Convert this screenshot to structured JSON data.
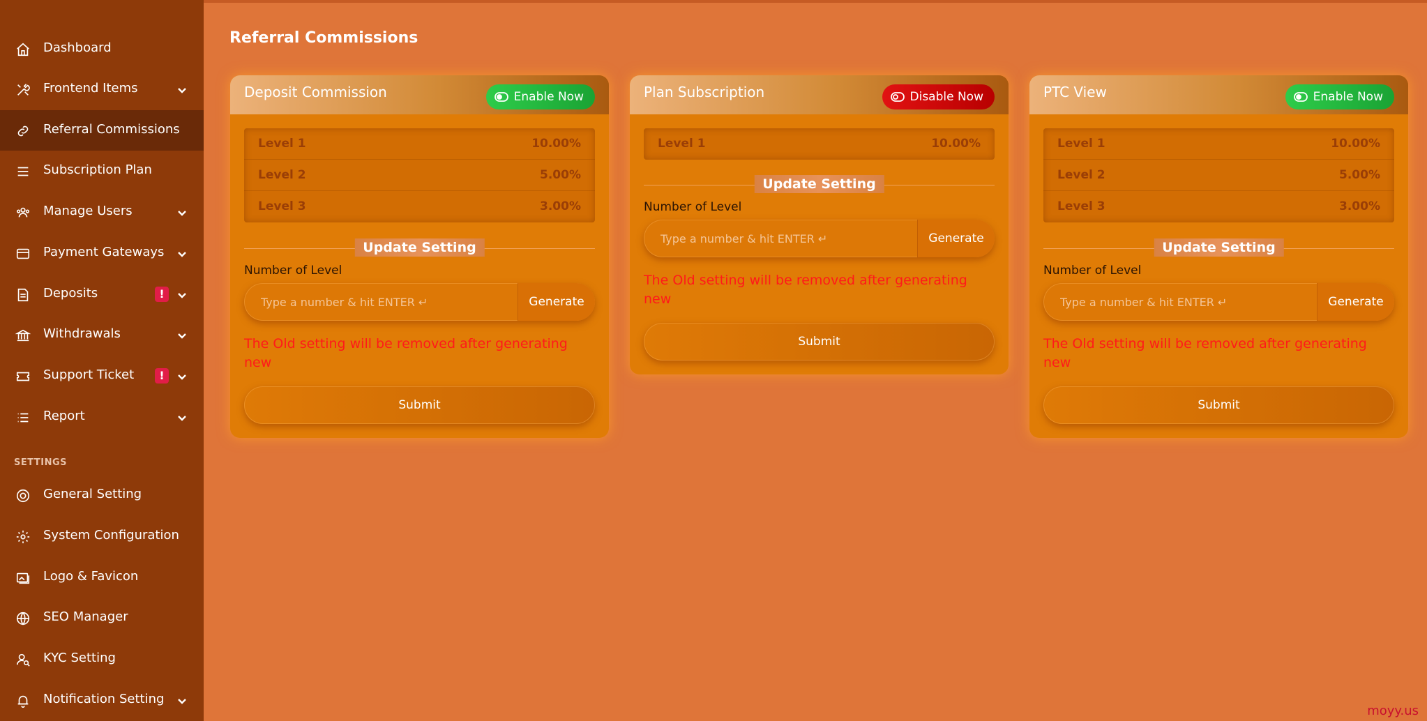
{
  "sidebar": {
    "items": [
      {
        "label": "Dashboard",
        "icon": "home-icon"
      },
      {
        "label": "Frontend Items",
        "icon": "tools-icon"
      },
      {
        "label": "Referral Commissions",
        "icon": "link-icon"
      },
      {
        "label": "Subscription Plan",
        "icon": "list-icon"
      },
      {
        "label": "Manage Users",
        "icon": "users-icon"
      },
      {
        "label": "Payment Gateways",
        "icon": "credit-card-icon"
      },
      {
        "label": "Deposits",
        "icon": "receipt-icon"
      },
      {
        "label": "Withdrawals",
        "icon": "bank-icon"
      },
      {
        "label": "Support Ticket",
        "icon": "ticket-icon"
      },
      {
        "label": "Report",
        "icon": "report-list-icon"
      }
    ],
    "settings_label": "SETTINGS",
    "settings_items": [
      {
        "label": "General Setting",
        "icon": "life-ring-icon"
      },
      {
        "label": "System Configuration",
        "icon": "gear-icon"
      },
      {
        "label": "Logo & Favicon",
        "icon": "images-icon"
      },
      {
        "label": "SEO Manager",
        "icon": "globe-icon"
      },
      {
        "label": "KYC Setting",
        "icon": "user-search-icon"
      },
      {
        "label": "Notification Setting",
        "icon": "bell-icon"
      }
    ],
    "badge_text": "!"
  },
  "page": {
    "title": "Referral Commissions"
  },
  "cards": [
    {
      "title": "Deposit Commission",
      "toggle_label": "Enable Now",
      "levels": [
        {
          "name": "Level 1",
          "percent": "10.00%"
        },
        {
          "name": "Level 2",
          "percent": "5.00%"
        },
        {
          "name": "Level 3",
          "percent": "3.00%"
        }
      ],
      "update_label": "Update Setting",
      "number_label": "Number of Level",
      "placeholder": "Type a number & hit ENTER ↵",
      "generate_label": "Generate",
      "warning": "The Old setting will be removed after generating new",
      "submit_label": "Submit"
    },
    {
      "title": "Plan Subscription",
      "toggle_label": "Disable Now",
      "levels": [
        {
          "name": "Level 1",
          "percent": "10.00%"
        }
      ],
      "update_label": "Update Setting",
      "number_label": "Number of Level",
      "placeholder": "Type a number & hit ENTER ↵",
      "generate_label": "Generate",
      "warning": "The Old setting will be removed after generating new",
      "submit_label": "Submit"
    },
    {
      "title": "PTC View",
      "toggle_label": "Enable Now",
      "levels": [
        {
          "name": "Level 1",
          "percent": "10.00%"
        },
        {
          "name": "Level 2",
          "percent": "5.00%"
        },
        {
          "name": "Level 3",
          "percent": "3.00%"
        }
      ],
      "update_label": "Update Setting",
      "number_label": "Number of Level",
      "placeholder": "Type a number & hit ENTER ↵",
      "generate_label": "Generate",
      "warning": "The Old setting will be removed after generating new",
      "submit_label": "Submit"
    }
  ],
  "colors": {
    "sidebar_bg": "#8e3a09",
    "main_bg": "#df7539",
    "enable_green": "#2ecc4a",
    "disable_red": "#e11212",
    "warning_red": "#ff1a1a"
  },
  "watermark": "moyy.us"
}
